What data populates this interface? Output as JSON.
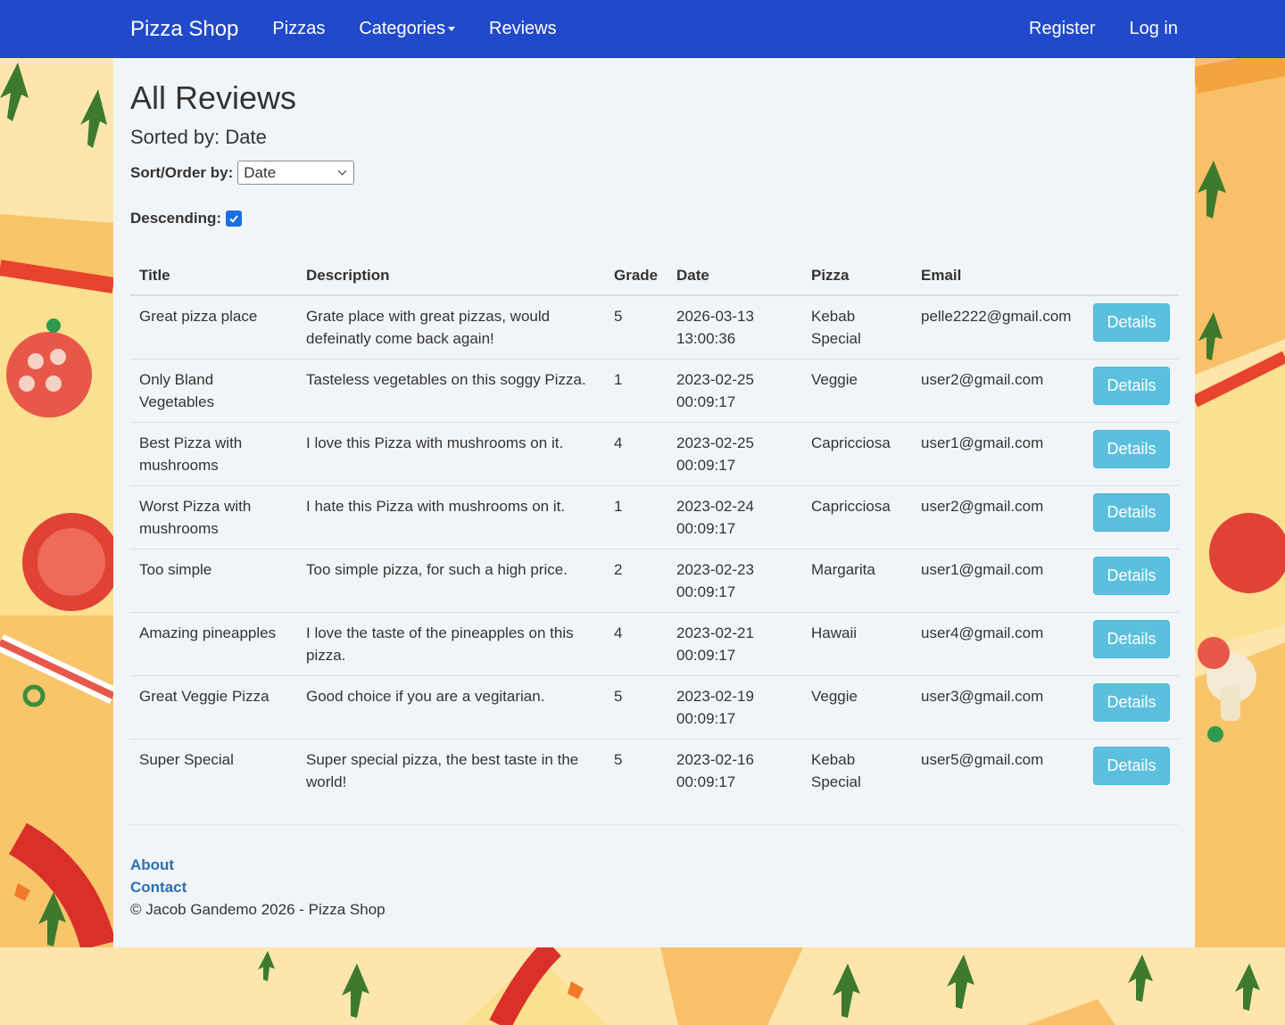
{
  "nav": {
    "brand": "Pizza Shop",
    "links": [
      "Pizzas",
      "Categories",
      "Reviews"
    ],
    "right_links": [
      "Register",
      "Log in"
    ]
  },
  "page": {
    "title": "All Reviews",
    "sorted_by": "Sorted by: Date",
    "sort_label": "Sort/Order by:",
    "sort_value": "Date",
    "descending_label": "Descending:",
    "descending_checked": true
  },
  "table": {
    "headers": [
      "Title",
      "Description",
      "Grade",
      "Date",
      "Pizza",
      "Email"
    ],
    "button_label": "Details",
    "rows": [
      {
        "title": "Great pizza place",
        "description": "Grate place with great pizzas, would defeinatly come back again!",
        "grade": "5",
        "date": "2026-03-13 13:00:36",
        "pizza": "Kebab Special",
        "email": "pelle2222@gmail.com"
      },
      {
        "title": "Only Bland Vegetables",
        "description": "Tasteless vegetables on this soggy Pizza.",
        "grade": "1",
        "date": "2023-02-25 00:09:17",
        "pizza": "Veggie",
        "email": "user2@gmail.com"
      },
      {
        "title": "Best Pizza with mushrooms",
        "description": "I love this Pizza with mushrooms on it.",
        "grade": "4",
        "date": "2023-02-25 00:09:17",
        "pizza": "Capricciosa",
        "email": "user1@gmail.com"
      },
      {
        "title": "Worst Pizza with mushrooms",
        "description": "I hate this Pizza with mushrooms on it.",
        "grade": "1",
        "date": "2023-02-24 00:09:17",
        "pizza": "Capricciosa",
        "email": "user2@gmail.com"
      },
      {
        "title": "Too simple",
        "description": "Too simple pizza, for such a high price.",
        "grade": "2",
        "date": "2023-02-23 00:09:17",
        "pizza": "Margarita",
        "email": "user1@gmail.com"
      },
      {
        "title": "Amazing pineapples",
        "description": "I love the taste of the pineapples on this pizza.",
        "grade": "4",
        "date": "2023-02-21 00:09:17",
        "pizza": "Hawaii",
        "email": "user4@gmail.com"
      },
      {
        "title": "Great Veggie Pizza",
        "description": "Good choice if you are a vegitarian.",
        "grade": "5",
        "date": "2023-02-19 00:09:17",
        "pizza": "Veggie",
        "email": "user3@gmail.com"
      },
      {
        "title": "Super Special",
        "description": "Super special pizza, the best taste in the world!",
        "grade": "5",
        "date": "2023-02-16 00:09:17",
        "pizza": "Kebab Special",
        "email": "user5@gmail.com"
      }
    ]
  },
  "footer": {
    "about": "About",
    "contact": "Contact",
    "copyright": "© Jacob Gandemo 2026 - Pizza Shop"
  },
  "colors": {
    "navbar": "#2149cb",
    "details_button": "#5bc0de",
    "link": "#2a6fb5",
    "background": "#fde7b0"
  }
}
